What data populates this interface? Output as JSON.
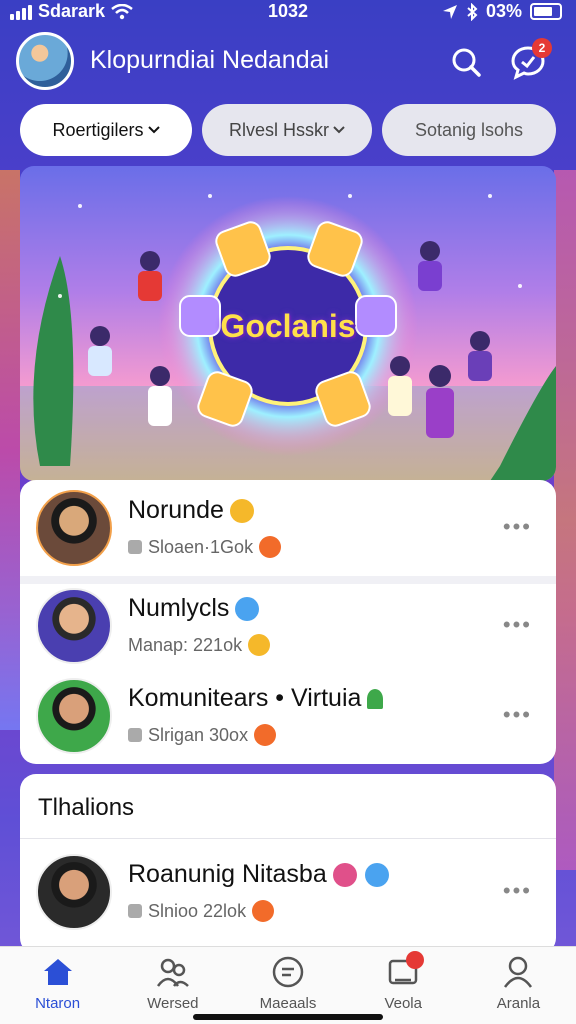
{
  "status_bar": {
    "carrier": "Sdarark",
    "time": "1032",
    "battery": "03%"
  },
  "header": {
    "title": "Klopurndiai Nedandai",
    "notification_count": "2"
  },
  "filters": [
    {
      "label": "Roertigilers",
      "active": true,
      "has_dropdown": true
    },
    {
      "label": "Rlvesl Hsskr",
      "active": false,
      "has_dropdown": true
    },
    {
      "label": "Sotanig lsohs",
      "active": false,
      "has_dropdown": false
    }
  ],
  "banner": {
    "title": "Goclanis"
  },
  "list_card": [
    {
      "name": "Norunde",
      "sub": "Sloaen·1Gok",
      "name_badge": "#f5b82a",
      "sub_badge": "#f26b2a"
    },
    {
      "name": "Numlycls",
      "sub": "Manap: 221ok",
      "name_badge": "#4aa3f0",
      "sub_badge": "#f5b82a"
    },
    {
      "name": "Komunitears • Virtuia",
      "sub": "Slrigan 30ox",
      "name_badge": "#3ea84a",
      "sub_badge": "#f26b2a"
    }
  ],
  "section": {
    "title": "Tlhalions",
    "items": [
      {
        "name": "Roanunig Nitasba",
        "sub": "Slnioo 22lok",
        "sub_badge": "#f26b2a"
      }
    ]
  },
  "bottom_nav": [
    {
      "label": "Ntaron",
      "icon": "home-icon",
      "active": true
    },
    {
      "label": "Wersed",
      "icon": "friends-icon",
      "active": false
    },
    {
      "label": "Maeaals",
      "icon": "chat-icon",
      "active": false
    },
    {
      "label": "Veola",
      "icon": "video-icon",
      "active": false,
      "badge": true
    },
    {
      "label": "Aranla",
      "icon": "profile-icon",
      "active": false
    }
  ],
  "colors": {
    "accent": "#2b4fd6",
    "badge": "#e53935",
    "background": "#5b3fd0"
  }
}
